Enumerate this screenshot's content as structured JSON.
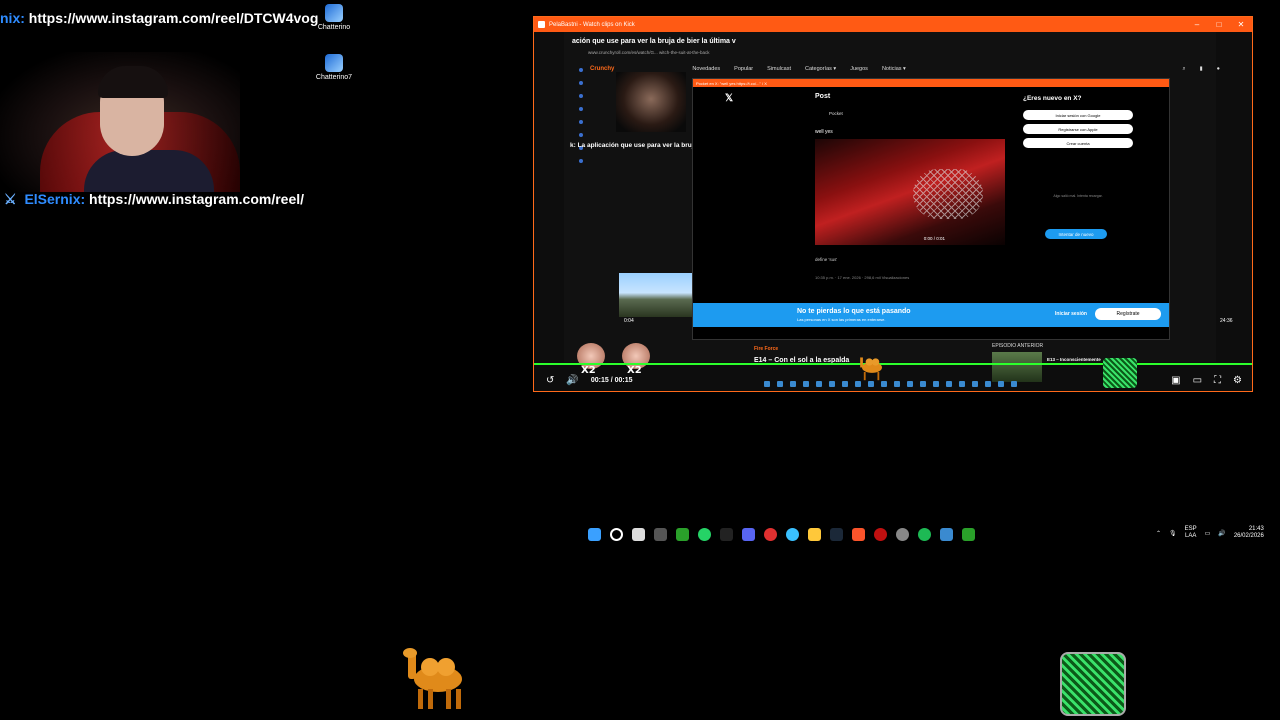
{
  "chat": {
    "line1_user": "nix:",
    "line1_msg": "https://www.instagram.com/reel/DTCW4vog",
    "line2_user": "ElSernix:",
    "line2_msg": "https://www.instagram.com/reel/"
  },
  "desktop_icons": [
    {
      "label": "Chatterino",
      "icon": "chatterino-icon"
    },
    {
      "label": "Chatterino7",
      "icon": "chatterino-icon"
    }
  ],
  "window": {
    "title": "PelaBastni - Watch clips on Kick",
    "controls": [
      "–",
      "□",
      "✕"
    ],
    "accent": "#ff5a14"
  },
  "inner": {
    "heading": "ación que use para ver la bruja de bier la última v",
    "address": "www.crunchyroll.com/es/watch/G... witch-the-suit-at-the-back",
    "nav": [
      "Novedades",
      "Popular",
      "Simulcast",
      "Categorías ▾",
      "Juegos",
      "Noticias ▾"
    ],
    "brand": "Crunchy",
    "subtitle": "k: La aplicación que use para ver la bruja de bier"
  },
  "x_post": {
    "bar": "Pocket en X: \"well yes https://t.co/...\" / X",
    "header": "Post",
    "author": "Pocket",
    "text": "well yes",
    "video_time": "0:00 / 0:01",
    "caption": "define 'sus'",
    "stats": "10:35 p.m. · 17 ene. 2026 · 298,6 mil Visualizaciones",
    "signup_title": "¿Eres nuevo en X?",
    "signup_buttons": [
      "Iniciar sesión con Google",
      "Registrarse con Apple",
      "Crear cuenta"
    ],
    "signup_note": "Algo salió mal. Intenta recargar.",
    "retry": "Intentar de nuevo",
    "banner_title": "No te pierdas lo que está pasando",
    "banner_sub": "Las personas en X son las primeras en enterarse.",
    "banner_login": "Iniciar sesión",
    "banner_register": "Regístrate"
  },
  "episode": {
    "label": "Fire Force",
    "title": "E14 – Con el sol a la espalda",
    "prev_label": "EPISODIO ANTERIOR",
    "prev_title": "E13 – Inconscientemente",
    "thumb_time": "0:04",
    "edge_time": "24:36"
  },
  "player": {
    "time": "00:15 / 00:15",
    "progress": 1.0,
    "progress_color": "#2cff2c"
  },
  "emotes": [
    "X2",
    "X2"
  ],
  "tray": {
    "lang1": "ESP",
    "lang2": "LAA",
    "time": "21:43",
    "date": "26/02/2026"
  }
}
